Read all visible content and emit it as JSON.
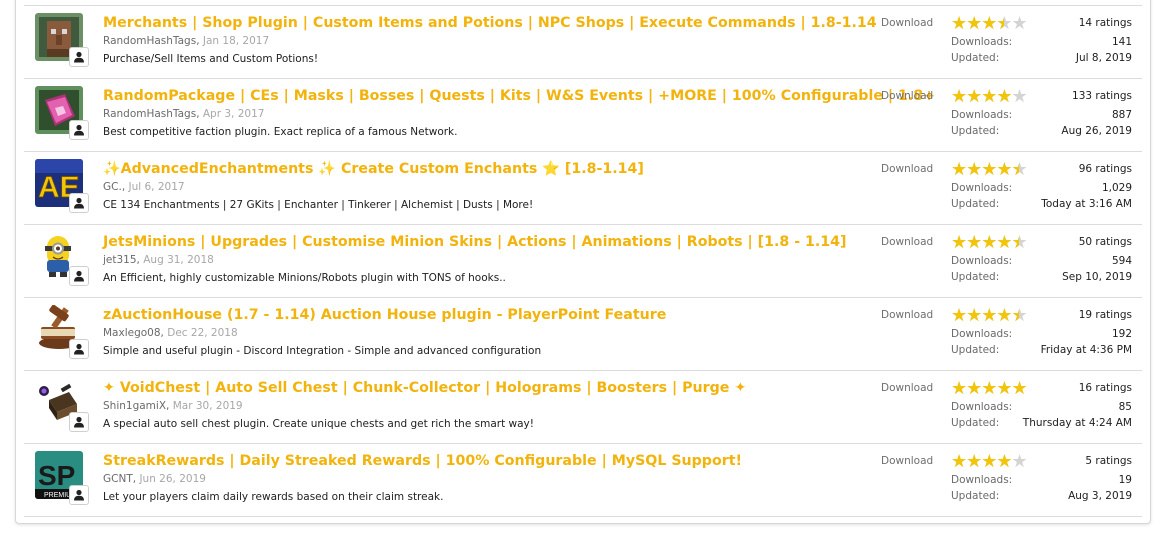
{
  "labels": {
    "download": "Download",
    "downloads": "Downloads:",
    "updated": "Updated:"
  },
  "colors": {
    "title": "#f2b30c",
    "star_on": "#f2c40a",
    "star_off": "#d4d4d4"
  },
  "resources": [
    {
      "icon": "merchant-villager-icon",
      "title": "Merchants | Shop Plugin | Custom Items and Potions | NPC Shops | Execute Commands | 1.8-1.14",
      "author": "RandomHashTags",
      "date": "Jan 18, 2017",
      "tagline": "Purchase/Sell Items and Custom Potions!",
      "rating": 3.5,
      "ratings": "14 ratings",
      "downloads": "141",
      "updated": "Jul 8, 2019"
    },
    {
      "icon": "enchanted-book-icon",
      "title": "RandomPackage | CEs | Masks | Bosses | Quests | Kits | W&S Events | +MORE | 100% Configurable | 1.8+",
      "author": "RandomHashTags",
      "date": "Apr 3, 2017",
      "tagline": "Best competitive faction plugin. Exact replica of a famous Network.",
      "rating": 4,
      "ratings": "133 ratings",
      "downloads": "887",
      "updated": "Aug 26, 2019"
    },
    {
      "icon": "ae-logo-icon",
      "title": "✨AdvancedEnchantments ✨ Create Custom Enchants ⭐ [1.8-1.14]",
      "author": "GC.",
      "date": "Jul 6, 2017",
      "tagline": "CE 134 Enchantments | 27 GKits | Enchanter | Tinkerer | Alchemist | Dusts | More!",
      "rating": 4.5,
      "ratings": "96 ratings",
      "downloads": "1,029",
      "updated": "Today at 3:16 AM"
    },
    {
      "icon": "minion-icon",
      "title": "JetsMinions | Upgrades | Customise Minion Skins | Actions | Animations | Robots | [1.8 - 1.14]",
      "author": "jet315",
      "date": "Aug 31, 2018",
      "tagline": "An Efficient, highly customizable Minions/Robots plugin with TONS of hooks..",
      "rating": 4.5,
      "ratings": "50 ratings",
      "downloads": "594",
      "updated": "Sep 10, 2019"
    },
    {
      "icon": "auction-gavel-icon",
      "title": "zAuctionHouse (1.7 - 1.14) Auction House plugin - PlayerPoint Feature",
      "author": "Maxlego08",
      "date": "Dec 22, 2018",
      "tagline": "Simple and useful plugin - Discord Integration - Simple and advanced configuration",
      "rating": 4.5,
      "ratings": "19 ratings",
      "downloads": "192",
      "updated": "Friday at 4:36 PM"
    },
    {
      "icon": "void-chest-icon",
      "title": "✦ VoidChest | Auto Sell Chest | Chunk-Collector | Holograms | Boosters | Purge ✦",
      "author": "Shin1gamiX",
      "date": "Mar 30, 2019",
      "tagline": "A special auto sell chest plugin. Create unique chests and get rich the smart way!",
      "rating": 5,
      "ratings": "16 ratings",
      "downloads": "85",
      "updated": "Thursday at 4:24 AM"
    },
    {
      "icon": "sp-premium-logo-icon",
      "logo_text": "SP",
      "logo_sub": "PREMIUM",
      "title": "StreakRewards | Daily Streaked Rewards | 100% Configurable | MySQL Support!",
      "author": "GCNT",
      "date": "Jun 26, 2019",
      "tagline": "Let your players claim daily rewards based on their claim streak.",
      "rating": 4,
      "ratings": "5 ratings",
      "downloads": "19",
      "updated": "Aug 3, 2019"
    }
  ]
}
